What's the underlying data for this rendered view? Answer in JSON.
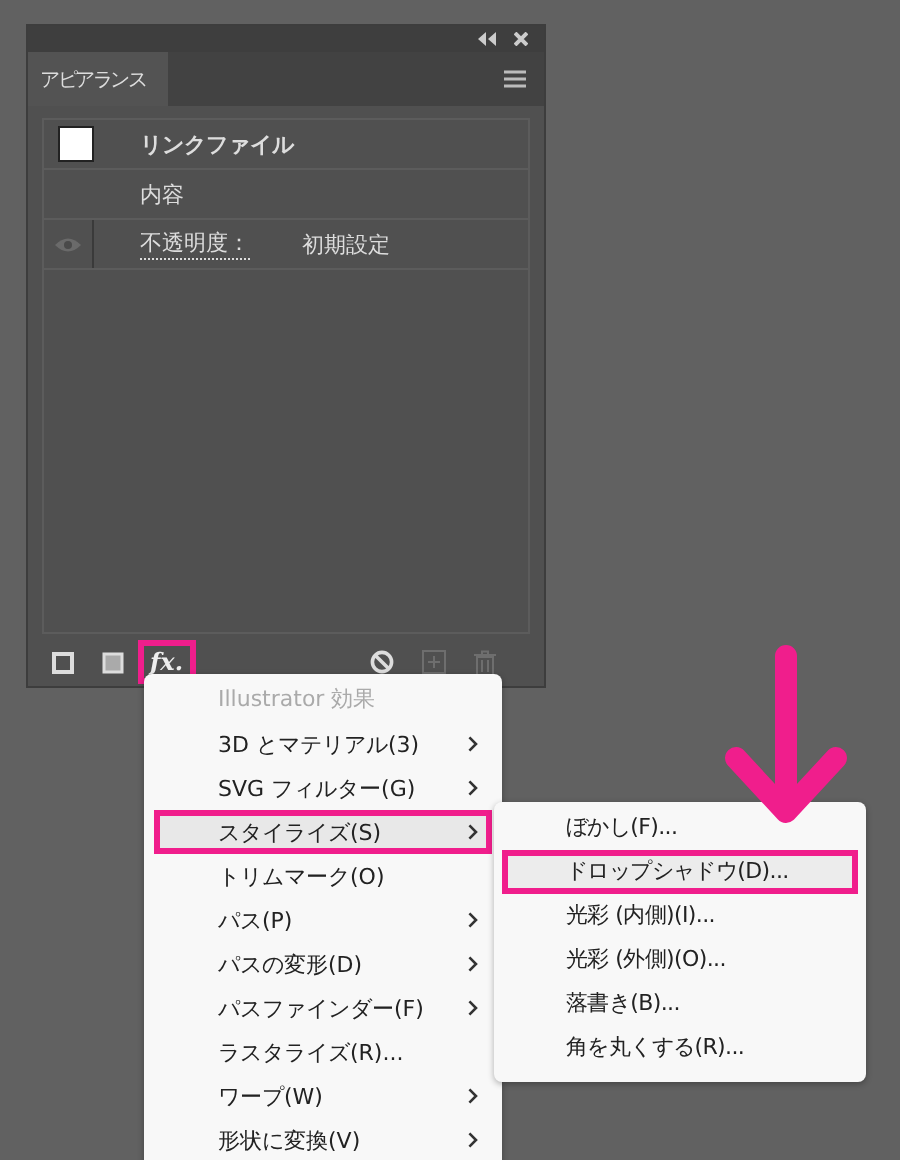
{
  "panel": {
    "tab": {
      "label": "アピアランス",
      "selected": true
    },
    "rows": [
      {
        "kind": "header",
        "label": "リンクファイル"
      },
      {
        "kind": "plain",
        "label": "内容"
      },
      {
        "kind": "opacity",
        "label": "不透明度：",
        "value": "初期設定",
        "visible": false
      }
    ],
    "toolbar": [
      {
        "kind": "stroke",
        "disabled": false
      },
      {
        "kind": "fill",
        "disabled": false
      },
      {
        "kind": "fx",
        "label": "fx.",
        "disabled": false,
        "highlighted": true
      },
      {
        "kind": "clear",
        "disabled": false
      },
      {
        "kind": "add",
        "disabled": true
      },
      {
        "kind": "delete",
        "disabled": true
      }
    ]
  },
  "menu": {
    "header": "Illustrator 効果",
    "items": [
      {
        "label": "3D とマテリアル(3)",
        "submenu": true,
        "selected": false
      },
      {
        "label": "SVG フィルター(G)",
        "submenu": true,
        "selected": false
      },
      {
        "label": "スタイライズ(S)",
        "submenu": true,
        "selected": true
      },
      {
        "label": "トリムマーク(O)",
        "submenu": false,
        "selected": false
      },
      {
        "label": "パス(P)",
        "submenu": true,
        "selected": false
      },
      {
        "label": "パスの変形(D)",
        "submenu": true,
        "selected": false
      },
      {
        "label": "パスファインダー(F)",
        "submenu": true,
        "selected": false
      },
      {
        "label": "ラスタライズ(R)...",
        "submenu": false,
        "selected": false
      },
      {
        "label": "ワープ(W)",
        "submenu": true,
        "selected": false
      },
      {
        "label": "形状に変換(V)",
        "submenu": true,
        "selected": false
      }
    ]
  },
  "submenu": {
    "items": [
      {
        "label": "ぼかし(F)...",
        "selected": false
      },
      {
        "label": "ドロップシャドウ(D)...",
        "selected": true
      },
      {
        "label": "光彩 (内側)(I)...",
        "selected": false
      },
      {
        "label": "光彩 (外側)(O)...",
        "selected": false
      },
      {
        "label": "落書き(B)...",
        "selected": false
      },
      {
        "label": "角を丸くする(R)...",
        "selected": false
      }
    ]
  }
}
